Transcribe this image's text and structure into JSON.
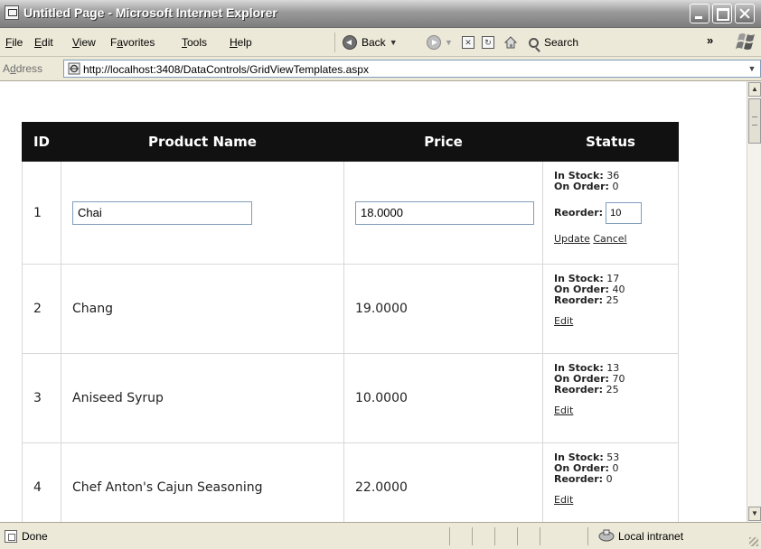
{
  "window": {
    "title": "Untitled Page - Microsoft Internet Explorer"
  },
  "menu": [
    {
      "prefix": "",
      "accel": "F",
      "rest": "ile"
    },
    {
      "prefix": "",
      "accel": "E",
      "rest": "dit"
    },
    {
      "prefix": "",
      "accel": "V",
      "rest": "iew"
    },
    {
      "prefix": "F",
      "accel": "a",
      "rest": "vorites"
    },
    {
      "prefix": "",
      "accel": "T",
      "rest": "ools"
    },
    {
      "prefix": "",
      "accel": "H",
      "rest": "elp"
    }
  ],
  "toolbar": {
    "back_label": "Back",
    "search_label": "Search",
    "overflow": "»"
  },
  "address": {
    "label_prefix": "A",
    "label_accel": "d",
    "label_rest": "dress",
    "url": "http://localhost:3408/DataControls/GridViewTemplates.aspx"
  },
  "grid": {
    "headers": [
      "ID",
      "Product Name",
      "Price",
      "Status"
    ],
    "status_labels": {
      "in_stock": "In Stock:",
      "on_order": "On Order:",
      "reorder": "Reorder:",
      "edit": "Edit",
      "update": "Update",
      "cancel": "Cancel"
    },
    "rows": [
      {
        "id": "1",
        "name": "Chai",
        "price": "18.0000",
        "in_stock": "36",
        "on_order": "0",
        "reorder": "10",
        "editing": true
      },
      {
        "id": "2",
        "name": "Chang",
        "price": "19.0000",
        "in_stock": "17",
        "on_order": "40",
        "reorder": "25",
        "editing": false
      },
      {
        "id": "3",
        "name": "Aniseed Syrup",
        "price": "10.0000",
        "in_stock": "13",
        "on_order": "70",
        "reorder": "25",
        "editing": false
      },
      {
        "id": "4",
        "name": "Chef Anton's Cajun Seasoning",
        "price": "22.0000",
        "in_stock": "53",
        "on_order": "0",
        "reorder": "0",
        "editing": false
      }
    ]
  },
  "statusbar": {
    "text": "Done",
    "zone": "Local intranet"
  },
  "icons": {
    "back": "back-arrow-icon",
    "forward": "forward-arrow-icon",
    "stop": "stop-icon",
    "refresh": "refresh-icon",
    "home": "home-icon",
    "search": "search-icon",
    "windows": "windows-logo-icon",
    "page": "ie-page-icon",
    "zone": "intranet-zone-icon"
  }
}
